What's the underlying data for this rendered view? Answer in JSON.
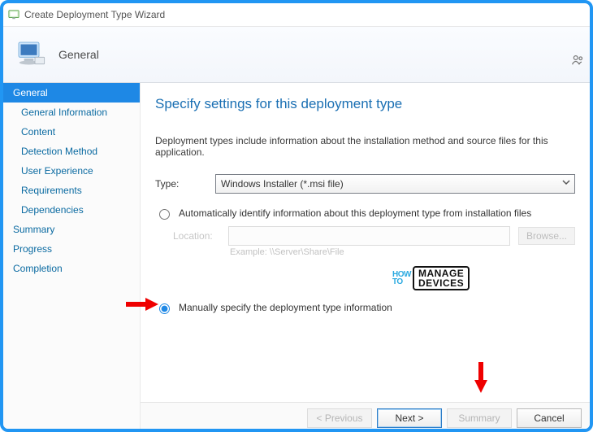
{
  "window": {
    "title": "Create Deployment Type Wizard"
  },
  "header": {
    "title": "General"
  },
  "sidebar": {
    "items": [
      {
        "label": "General",
        "selected": true,
        "indent": false
      },
      {
        "label": "General Information",
        "selected": false,
        "indent": true
      },
      {
        "label": "Content",
        "selected": false,
        "indent": true
      },
      {
        "label": "Detection Method",
        "selected": false,
        "indent": true
      },
      {
        "label": "User Experience",
        "selected": false,
        "indent": true
      },
      {
        "label": "Requirements",
        "selected": false,
        "indent": true
      },
      {
        "label": "Dependencies",
        "selected": false,
        "indent": true
      },
      {
        "label": "Summary",
        "selected": false,
        "indent": false
      },
      {
        "label": "Progress",
        "selected": false,
        "indent": false
      },
      {
        "label": "Completion",
        "selected": false,
        "indent": false
      }
    ]
  },
  "page": {
    "heading": "Specify settings for this deployment type",
    "description": "Deployment types include information about the installation method and source files for this application.",
    "type_label": "Type:",
    "type_value": "Windows Installer (*.msi file)",
    "radio_auto": "Automatically identify information about this deployment type from installation files",
    "location_label": "Location:",
    "location_value": "",
    "browse_label": "Browse...",
    "example_label": "Example: \\\\Server\\Share\\File",
    "radio_manual": "Manually specify the deployment type information",
    "selected_radio": "manual"
  },
  "watermark": {
    "small1": "HOW",
    "small2": "TO",
    "big1": "MANAGE",
    "big2": "DEVICES"
  },
  "footer": {
    "previous": "< Previous",
    "next": "Next >",
    "summary": "Summary",
    "cancel": "Cancel"
  }
}
